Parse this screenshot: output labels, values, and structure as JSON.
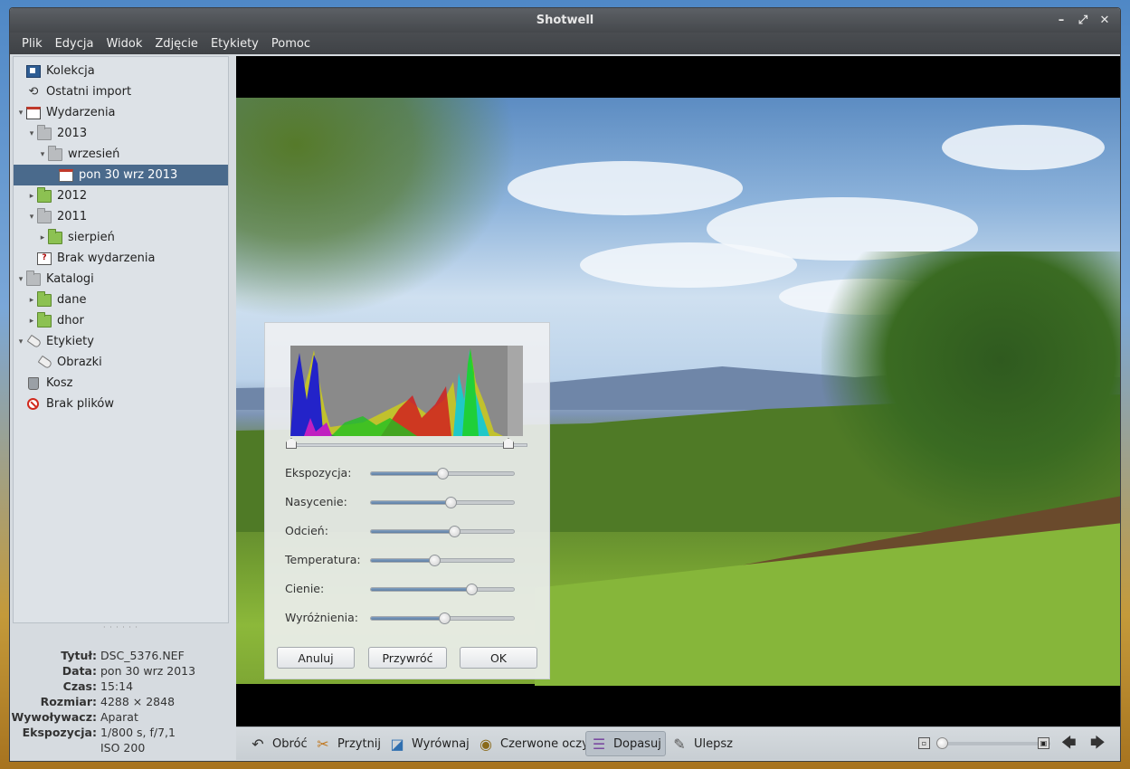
{
  "window": {
    "title": "Shotwell"
  },
  "menu": [
    "Plik",
    "Edycja",
    "Widok",
    "Zdjęcie",
    "Etykiety",
    "Pomoc"
  ],
  "sidebar": {
    "items": [
      {
        "label": "Kolekcja",
        "icon": "collection-icon",
        "level": 0,
        "expander": ""
      },
      {
        "label": "Ostatni import",
        "icon": "undo-icon",
        "level": 0,
        "expander": ""
      },
      {
        "label": "Wydarzenia",
        "icon": "events-icon",
        "level": 0,
        "expander": "▾"
      },
      {
        "label": "2013",
        "icon": "folder-icon",
        "level": 1,
        "expander": "▾"
      },
      {
        "label": "wrzesień",
        "icon": "folder-icon",
        "level": 2,
        "expander": "▾"
      },
      {
        "label": "pon 30 wrz 2013",
        "icon": "calendar-icon",
        "level": 3,
        "expander": "",
        "selected": true
      },
      {
        "label": "2012",
        "icon": "folder-green-icon",
        "level": 1,
        "expander": "▸"
      },
      {
        "label": "2011",
        "icon": "folder-icon",
        "level": 1,
        "expander": "▾"
      },
      {
        "label": "sierpień",
        "icon": "folder-green-icon",
        "level": 2,
        "expander": "▸"
      },
      {
        "label": "Brak wydarzenia",
        "icon": "unknown-event-icon",
        "level": 1,
        "expander": ""
      },
      {
        "label": "Katalogi",
        "icon": "folder-icon",
        "level": 0,
        "expander": "▾"
      },
      {
        "label": "dane",
        "icon": "folder-green-icon",
        "level": 1,
        "expander": "▸"
      },
      {
        "label": "dhor",
        "icon": "folder-green-icon",
        "level": 1,
        "expander": "▸"
      },
      {
        "label": "Etykiety",
        "icon": "tag-icon",
        "level": 0,
        "expander": "▾"
      },
      {
        "label": "Obrazki",
        "icon": "tag-icon",
        "level": 1,
        "expander": ""
      },
      {
        "label": "Kosz",
        "icon": "trash-icon",
        "level": 0,
        "expander": ""
      },
      {
        "label": "Brak plików",
        "icon": "missing-files-icon",
        "level": 0,
        "expander": ""
      }
    ]
  },
  "info": {
    "rows": [
      {
        "label": "Tytuł:",
        "value": "DSC_5376.NEF"
      },
      {
        "label": "Data:",
        "value": "pon 30 wrz 2013"
      },
      {
        "label": "Czas:",
        "value": "15:14"
      },
      {
        "label": "Rozmiar:",
        "value": "4288 × 2848"
      },
      {
        "label": "Wywoływacz:",
        "value": "Aparat"
      },
      {
        "label": "Ekspozycja:",
        "value": "1/800 s, f/7,1"
      },
      {
        "label": "",
        "value": "ISO 200"
      }
    ]
  },
  "adjust": {
    "sliders": [
      {
        "label": "Ekspozycja:",
        "value": 0.5
      },
      {
        "label": "Nasycenie:",
        "value": 0.56
      },
      {
        "label": "Odcień:",
        "value": 0.58
      },
      {
        "label": "Temperatura:",
        "value": 0.44
      },
      {
        "label": "Cienie:",
        "value": 0.7
      },
      {
        "label": "Wyróżnienia:",
        "value": 0.51
      }
    ],
    "buttons": {
      "cancel": "Anuluj",
      "reset": "Przywróć",
      "ok": "OK"
    }
  },
  "toolbar": {
    "items": [
      {
        "label": "Obróć",
        "icon": "rotate-icon"
      },
      {
        "label": "Przytnij",
        "icon": "crop-icon"
      },
      {
        "label": "Wyrównaj",
        "icon": "straighten-icon"
      },
      {
        "label": "Czerwone oczy",
        "icon": "red-eye-icon"
      },
      {
        "label": "Dopasuj",
        "icon": "adjust-icon",
        "active": true
      },
      {
        "label": "Ulepsz",
        "icon": "enhance-icon"
      }
    ],
    "zoom_level": 0.0
  }
}
